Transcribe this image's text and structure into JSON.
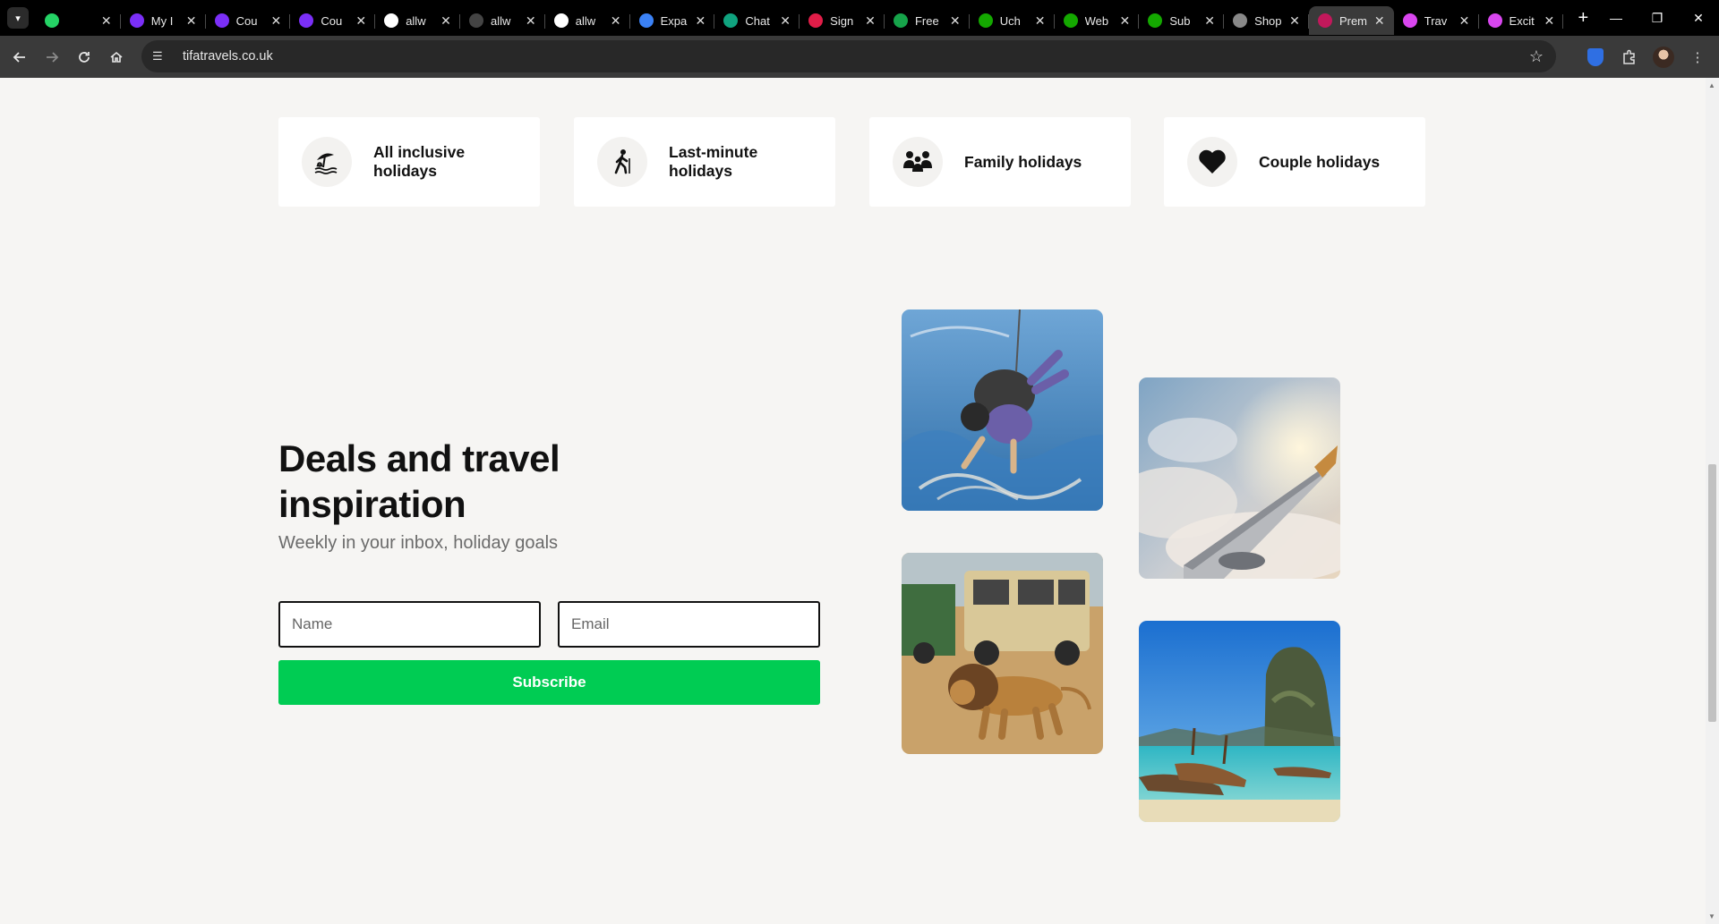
{
  "browser": {
    "tabs": [
      {
        "title": "",
        "favicon_color": "#25d366",
        "favicon": "whatsapp-icon"
      },
      {
        "title": "My I",
        "favicon_color": "#7b2ff7",
        "favicon": "u-icon"
      },
      {
        "title": "Cou",
        "favicon_color": "#7b2ff7",
        "favicon": "u-icon"
      },
      {
        "title": "Cou",
        "favicon_color": "#7b2ff7",
        "favicon": "u-icon"
      },
      {
        "title": "allw",
        "favicon_color": "#ffffff",
        "favicon": "github-icon"
      },
      {
        "title": "allw",
        "favicon_color": "#444444",
        "favicon": "spinner-icon"
      },
      {
        "title": "allw",
        "favicon_color": "#ffffff",
        "favicon": "github-icon"
      },
      {
        "title": "Expa",
        "favicon_color": "#3b82f6",
        "favicon": "expo-icon"
      },
      {
        "title": "Chat",
        "favicon_color": "#10a37f",
        "favicon": "chatgpt-icon"
      },
      {
        "title": "Sign",
        "favicon_color": "#e11d48",
        "favicon": "ring-icon"
      },
      {
        "title": "Free",
        "favicon_color": "#16a34a",
        "favicon": "sheet-icon"
      },
      {
        "title": "Uch",
        "favicon_color": "#14a800",
        "favicon": "upwork-icon"
      },
      {
        "title": "Web",
        "favicon_color": "#14a800",
        "favicon": "upwork-icon"
      },
      {
        "title": "Sub",
        "favicon_color": "#14a800",
        "favicon": "upwork-icon"
      },
      {
        "title": "Shop",
        "favicon_color": "#888888",
        "favicon": "arc-icon"
      },
      {
        "title": "Prem",
        "favicon_color": "#c2185b",
        "favicon": "tifa-icon",
        "active": true
      },
      {
        "title": "Trav",
        "favicon_color": "#d946ef",
        "favicon": "t-icon"
      },
      {
        "title": "Excit",
        "favicon_color": "#d946ef",
        "favicon": "t-icon"
      }
    ],
    "url": "tifatravels.co.uk"
  },
  "categories": [
    {
      "label": "All inclusive holidays",
      "icon": "beach-umbrella-icon"
    },
    {
      "label": "Last-minute holidays",
      "icon": "walking-traveler-icon"
    },
    {
      "label": "Family holidays",
      "icon": "family-icon"
    },
    {
      "label": "Couple holidays",
      "icon": "heart-icon"
    }
  ],
  "newsletter": {
    "title": "Deals and travel inspiration",
    "subtitle": "Weekly in your inbox, holiday goals",
    "name_placeholder": "Name",
    "email_placeholder": "Email",
    "button": "Subscribe"
  },
  "gallery": [
    {
      "subject": "skydiving"
    },
    {
      "subject": "airplane-wing"
    },
    {
      "subject": "safari-lion"
    },
    {
      "subject": "tropical-beach"
    }
  ],
  "colors": {
    "accent": "#00cc53",
    "page_bg": "#f6f5f3"
  }
}
